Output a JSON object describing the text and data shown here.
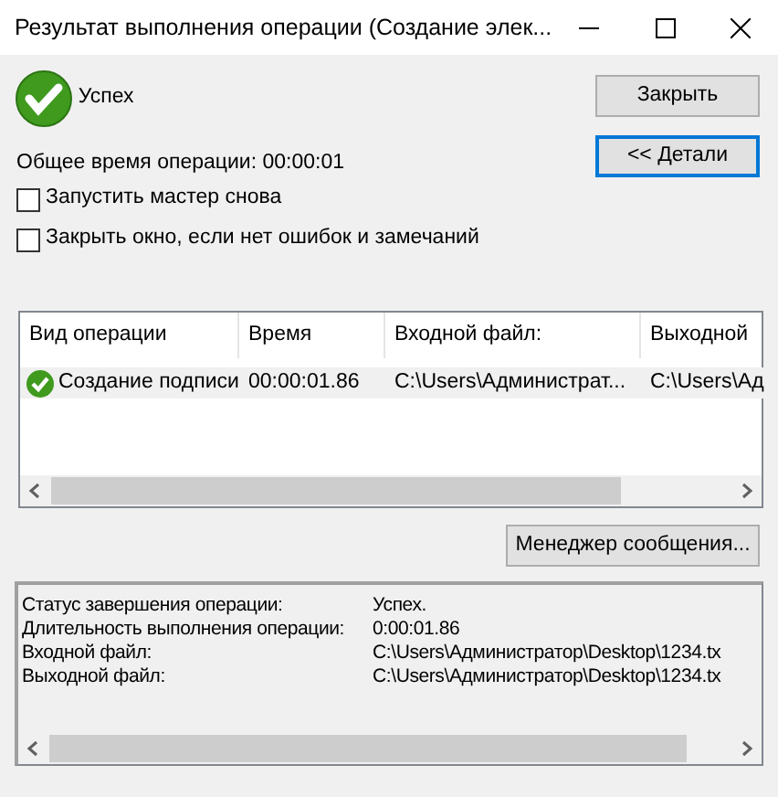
{
  "window": {
    "title": "Результат выполнения операции (Создание элек..."
  },
  "result": {
    "status": "Успех",
    "total_time": "Общее время операции: 00:00:01"
  },
  "options": [
    {
      "label": "Запустить мастер снова",
      "checked": false
    },
    {
      "label": "Закрыть окно, если нет ошибок и замечаний",
      "checked": false
    }
  ],
  "buttons": [
    {
      "label": "Закрыть",
      "focused": false
    },
    {
      "label": "<< Детали",
      "focused": true
    }
  ],
  "table": {
    "columns": [
      "Вид операции",
      "Время",
      "Входной файл:",
      "Выходной"
    ],
    "rows": [
      {
        "selected": true,
        "cells": [
          "Создание подписи",
          "00:00:01.86",
          "C:\\Users\\Администрат...",
          "C:\\Users\\Ад"
        ]
      }
    ]
  },
  "message_button": "Менеджер сообщения...",
  "details": [
    {
      "label": "Статус завершения операции:",
      "value": "Успех."
    },
    {
      "label": "Длительность выполнения операции:",
      "value": "0:00:01.86"
    },
    {
      "label": "Входной файл:",
      "value": "C:\\Users\\Администратор\\Desktop\\1234.tx"
    },
    {
      "label": "Выходной файл:",
      "value": "C:\\Users\\Администратор\\Desktop\\1234.tx"
    }
  ]
}
